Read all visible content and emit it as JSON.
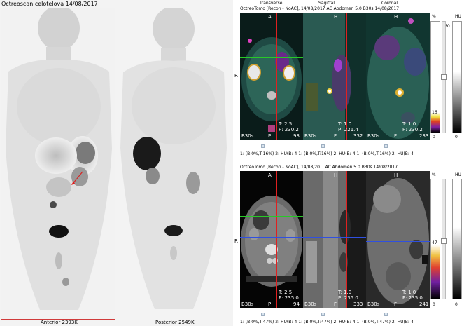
{
  "scan": {
    "title": "Octreoscan celotelova 14/08/2017",
    "anterior_label": "Anterior 2393K",
    "posterior_label": "Posterior 2549K"
  },
  "top": {
    "header": "OctreoTomo [Recon - NoAC], 14/08/2017    AC Abdomen 5.0 B30s 14/08/2017",
    "transverse_title": "Transverse",
    "sagittal_title": "Sagittal",
    "coronal_title": "Coronal",
    "transverse": {
      "t": "T: 2.5",
      "p": "P: 230.2",
      "num": "93",
      "b": "B30s"
    },
    "sagittal": {
      "t": "T: 1.0",
      "p": "P: 221.4",
      "num": "332",
      "b": "B30s"
    },
    "coronal": {
      "t": "T: 1.0",
      "p": "P: 230.2",
      "num": "233",
      "b": "B30s"
    },
    "footer": "1: (B:0%,T:16%) 2: HU(B:-4 1: (B:0%,T:16%) 2: HU(B:-4 1: (B:0%,T:16%) 2: HU(B:-4",
    "scale": {
      "pct": "%",
      "hu": "HU",
      "max": "60",
      "mid": "16",
      "zero": "0"
    }
  },
  "bottom": {
    "header": "OctreoTomo [Recon - NoAC], 14/08/20...    AC Abdomen 5.0 B30s 14/08/2017",
    "transverse": {
      "t": "T: 2.5",
      "p": "P: 235.0",
      "num": "94",
      "b": "B30s"
    },
    "sagittal": {
      "t": "T: 1.0",
      "p": "P: 235.0",
      "num": "333",
      "b": "B30s"
    },
    "coronal": {
      "t": "T: 1.0",
      "p": "P: 235.0",
      "num": "241",
      "b": "B30s"
    },
    "footer": "1: (B:0%,T:47%) 2: HU(B:-4 1: (B:0%,T:47%) 2: HU(B:-4 1: (B:0%,T:47%) 2: HU(B:-4",
    "scale": {
      "pct": "%",
      "hu": "HU",
      "max": "",
      "mid": "47",
      "zero": "0"
    }
  },
  "orient": {
    "a": "A",
    "p": "P",
    "r": "R",
    "l": "L",
    "h": "H",
    "f": "F"
  },
  "colors": {
    "selection": "#d03a3a",
    "crosshair_v": "#e02020",
    "crosshair_h_green": "#28c828",
    "crosshair_h_blue": "#3050e0"
  }
}
